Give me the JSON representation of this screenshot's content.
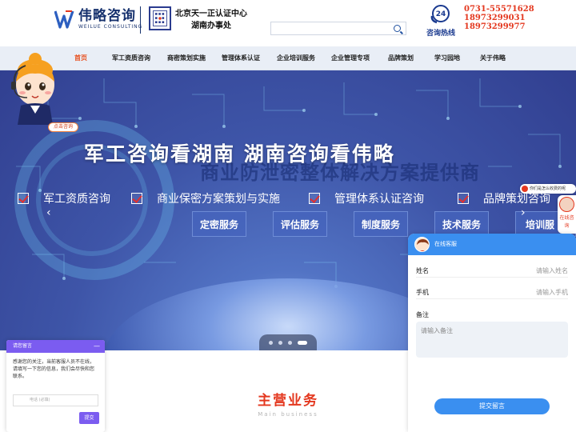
{
  "header": {
    "logo_cn": "伟略咨询",
    "logo_en": "WEILUE CONSULTING",
    "partner_line1": "北京天一正认证中心",
    "partner_line2": "湖南办事处",
    "hotline_badge": "24",
    "hotline_label": "咨询热线",
    "phones": [
      "0731-55571628",
      "18973299031",
      "18973299977"
    ]
  },
  "nav": {
    "items": [
      "首页",
      "军工资质咨询",
      "商密策划实施",
      "管理体系认证",
      "企业培训服务",
      "企业管理专项",
      "品牌策划",
      "学习园地",
      "关于伟略"
    ],
    "active_index": 0
  },
  "banner": {
    "title": "军工咨询看湖南   湖南咨询看伟略",
    "subtitle": "商业防泄密整体解决方案提供商",
    "features": [
      "军工资质咨询",
      "商业保密方案策划与实施",
      "管理体系认证咨询",
      "品牌策划咨询"
    ],
    "services": [
      "定密服务",
      "评估服务",
      "制度服务",
      "技术服务",
      "培训服"
    ],
    "prev_arrow": "‹",
    "next_arrow": "›",
    "slide_count": 4,
    "active_slide": 3
  },
  "mascot": {
    "button_label": "点击咨询"
  },
  "main_business": {
    "title": "主营业务",
    "subtitle": "Main business"
  },
  "leave_message": {
    "title": "请您留言",
    "minimize": "—",
    "message": "感谢您的关注，当前客服人员不在线，请填写一下您的信息，我们会尽快和您联系。",
    "phone_placeholder": "电话 (必填)",
    "submit": "提交"
  },
  "chat": {
    "title": "在线客服",
    "name_label": "姓名",
    "name_placeholder": "请输入姓名",
    "phone_label": "手机",
    "phone_placeholder": "请输入手机",
    "note_label": "备注",
    "note_placeholder": "请输入备注",
    "submit": "提交留言"
  },
  "side": {
    "bubble": "你们是怎么收费的呢",
    "label": "在线咨询"
  },
  "colors": {
    "brand_navy": "#17326e",
    "accent_red": "#e4381f",
    "chat_blue": "#3a8ff0",
    "leave_purple": "#7b5cf0"
  }
}
